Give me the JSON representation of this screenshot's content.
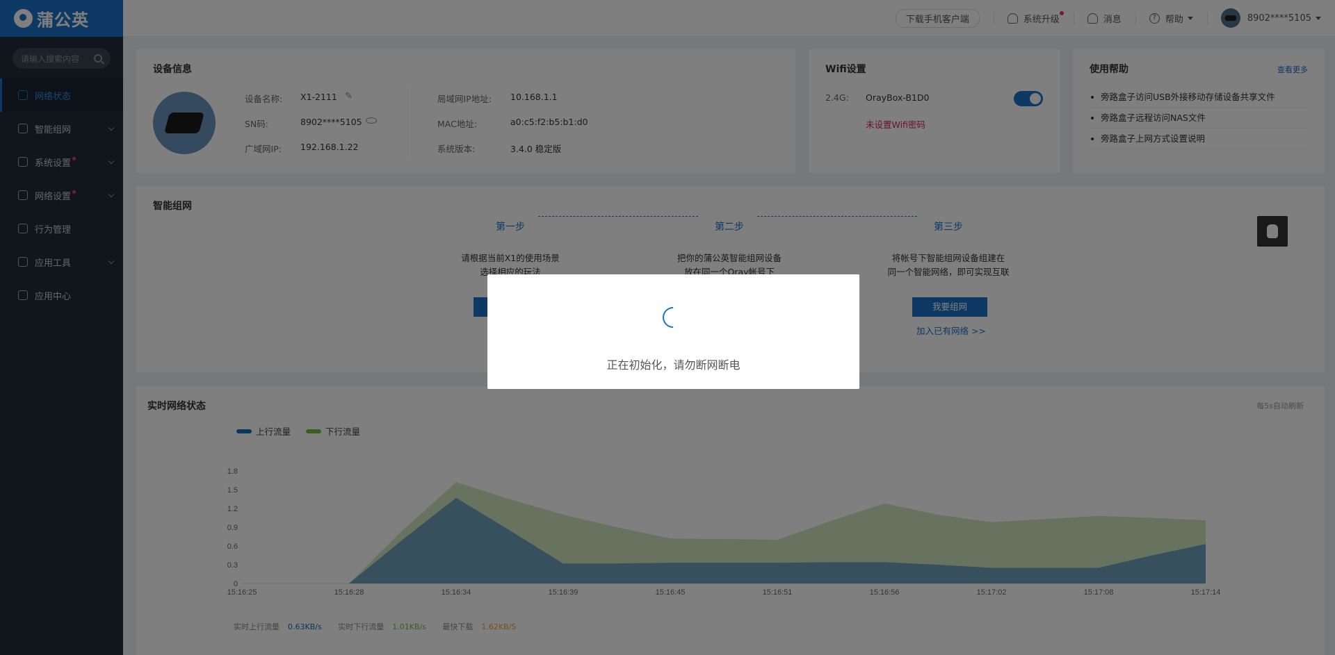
{
  "app": {
    "logo_text": "蒲公英"
  },
  "sidebar": {
    "search_placeholder": "请输入搜索内容",
    "items": [
      {
        "label": "网络状态",
        "active": true
      },
      {
        "label": "智能组网"
      },
      {
        "label": "系统设置",
        "badge": true
      },
      {
        "label": "网络设置",
        "badge": true
      },
      {
        "label": "行为管理"
      },
      {
        "label": "应用工具"
      },
      {
        "label": "应用中心"
      }
    ]
  },
  "topbar": {
    "download_client": "下载手机客户端",
    "upgrade": "系统升级",
    "messages": "消息",
    "help": "帮助",
    "user": "8902****5105"
  },
  "device_info": {
    "title": "设备信息",
    "name_label": "设备名称:",
    "name_value": "X1-2111",
    "sn_label": "SN码:",
    "sn_value": "8902****5105",
    "wan_label": "广域网IP:",
    "wan_value": "192.168.1.22",
    "lan_label": "局域网IP地址:",
    "lan_value": "10.168.1.1",
    "mac_label": "MAC地址:",
    "mac_value": "a0:c5:f2:b5:b1:d0",
    "version_label": "系统版本:",
    "version_value": "3.4.0 稳定版"
  },
  "wifi": {
    "title": "Wifi设置",
    "band_label": "2.4G:",
    "ssid": "OrayBox-B1D0",
    "warning": "未设置Wifi密码",
    "enabled": true
  },
  "help": {
    "title": "使用帮助",
    "more": "查看更多",
    "items": [
      "旁路盒子访问USB外接移动存储设备共享文件",
      "旁路盒子远程访问NAS文件",
      "旁路盒子上网方式设置说明"
    ]
  },
  "smart_network": {
    "title": "智能组网",
    "steps": [
      {
        "title": "第一步",
        "desc1": "请根据当前X1的使用场景",
        "desc2": "选择相应的玩法"
      },
      {
        "title": "第二步",
        "desc1": "把你的蒲公英智能组网设备",
        "desc2": "放在同一个Oray帐号下"
      },
      {
        "title": "第三步",
        "desc1": "将帐号下智能组网设备组建在",
        "desc2": "同一个智能网络，即可实现互联"
      }
    ],
    "create_button": "我要组网",
    "join_link": "加入已有网络 >>"
  },
  "realtime": {
    "title": "实时网络状态",
    "auto_refresh": "每5s自动刷新",
    "stats": {
      "up_label": "实时上行流量",
      "up_value": "0.63KB/s",
      "down_label": "实时下行流量",
      "down_value": "1.01KB/s",
      "max_label": "最快下载",
      "max_value": "1.62KB/S"
    },
    "colors": {
      "up": "#1a6ab8",
      "down": "#7ab648",
      "max": "#e8a030"
    }
  },
  "chart_data": {
    "type": "area",
    "x": [
      "15:16:25",
      "",
      "15:16:28",
      "",
      "15:16:34",
      "",
      "15:16:39",
      "",
      "15:16:45",
      "",
      "15:16:51",
      "",
      "15:16:56",
      "",
      "15:17:02",
      "",
      "15:17:08",
      "",
      "15:17:14"
    ],
    "tick_labels": [
      "15:16:25",
      "15:16:28",
      "15:16:34",
      "15:16:39",
      "15:16:45",
      "15:16:51",
      "15:16:56",
      "15:17:02",
      "15:17:08",
      "15:17:14"
    ],
    "yticks": [
      "0",
      "0.3",
      "0.6",
      "0.9",
      "1.2",
      "1.5",
      "1.8"
    ],
    "ylim": [
      0,
      1.8
    ],
    "series": [
      {
        "name": "上行流量",
        "color": "#1a6ab8",
        "values": [
          0,
          0,
          0,
          0.7,
          1.37,
          0.85,
          0.32,
          0.32,
          0.33,
          0.33,
          0.33,
          0.34,
          0.34,
          0.3,
          0.25,
          0.25,
          0.25,
          0.45,
          0.63
        ]
      },
      {
        "name": "下行流量",
        "color": "#7ab648",
        "values": [
          0,
          0,
          0,
          0.85,
          1.62,
          1.35,
          1.1,
          0.9,
          0.72,
          0.71,
          0.7,
          1.0,
          1.28,
          1.1,
          0.98,
          1.03,
          1.08,
          1.05,
          1.01
        ]
      }
    ],
    "legend": "top-left",
    "grid": false
  },
  "modal": {
    "message": "正在初始化，请勿断网断电"
  }
}
